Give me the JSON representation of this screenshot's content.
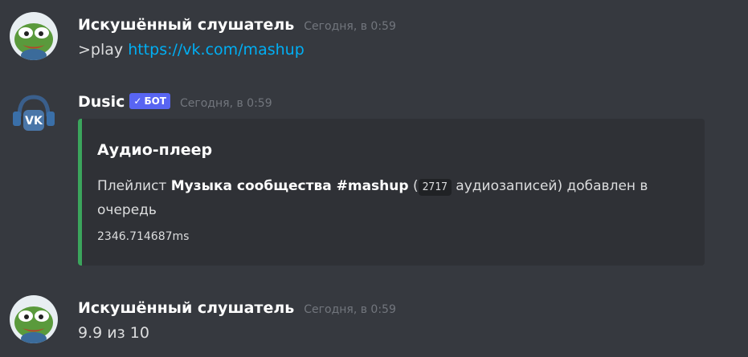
{
  "colors": {
    "background": "#36393f",
    "embed_background": "#2f3136",
    "embed_accent": "#3ba55c",
    "link": "#00aff4",
    "bot_tag": "#5865f2",
    "timestamp": "#72767d"
  },
  "messages": [
    {
      "author": "Искушённый слушатель",
      "timestamp": "Сегодня, в 0:59",
      "avatar_icon": "pepe-frog-avatar",
      "content_prefix": ">play ",
      "content_link": "https://vk.com/mashup"
    },
    {
      "author": "Dusic",
      "bot_tag": "БОТ",
      "bot_check_icon": "checkmark-icon",
      "timestamp": "Сегодня, в 0:59",
      "avatar_icon": "vk-headphones-avatar",
      "embed": {
        "title": "Аудио-плеер",
        "desc_prefix": "Плейлист ",
        "desc_bold": "Музыка сообщества #mashup",
        "desc_paren_open": " (",
        "desc_code": "2717",
        "desc_suffix": " аудиозаписей) добавлен в очередь",
        "footer": "2346.714687ms"
      }
    },
    {
      "author": "Искушённый слушатель",
      "timestamp": "Сегодня, в 0:59",
      "avatar_icon": "pepe-frog-avatar",
      "content": "9.9 из 10"
    }
  ]
}
